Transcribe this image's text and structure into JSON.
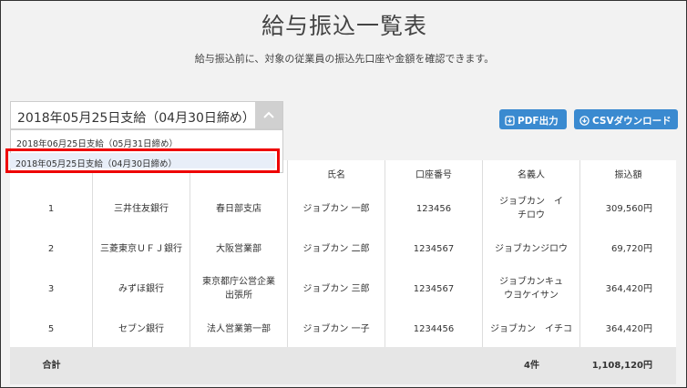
{
  "page": {
    "title": "給与振込一覧表",
    "subtitle": "給与振込前に、対象の従業員の振込先口座や金額を確認できます。"
  },
  "period_select": {
    "selected": "2018年05月25日支給（04月30日締め）",
    "options": [
      "2018年06月25日支給（05月31日締め）",
      "2018年05月25日支給（04月30日締め）"
    ]
  },
  "toolbar": {
    "pdf_label": "PDF出力",
    "csv_label": "CSVダウンロード"
  },
  "table": {
    "headers": [
      "",
      "",
      "",
      "氏名",
      "口座番号",
      "名義人",
      "振込額"
    ],
    "rows": [
      [
        "1",
        "三井住友銀行",
        "春日部支店",
        "ジョブカン 一郎",
        "123456",
        "ジョブカン　イチロウ",
        "309,560円"
      ],
      [
        "2",
        "三菱東京ＵＦＪ銀行",
        "大阪営業部",
        "ジョブカン 二郎",
        "1234567",
        "ジョブカンジロウ",
        "69,720円"
      ],
      [
        "3",
        "みずほ銀行",
        "東京都庁公営企業出張所",
        "ジョブカン 三郎",
        "1234567",
        "ジョブカンキュウヨケイサン",
        "364,420円"
      ],
      [
        "5",
        "セブン銀行",
        "法人営業第一部",
        "ジョブカン 一子",
        "1234456",
        "ジョブカン　イチコ",
        "364,420円"
      ]
    ],
    "total": {
      "label": "合計",
      "count": "4件",
      "amount": "1,108,120円"
    }
  },
  "colors": {
    "accent": "#3a8ad0",
    "highlight": "#e00000"
  }
}
